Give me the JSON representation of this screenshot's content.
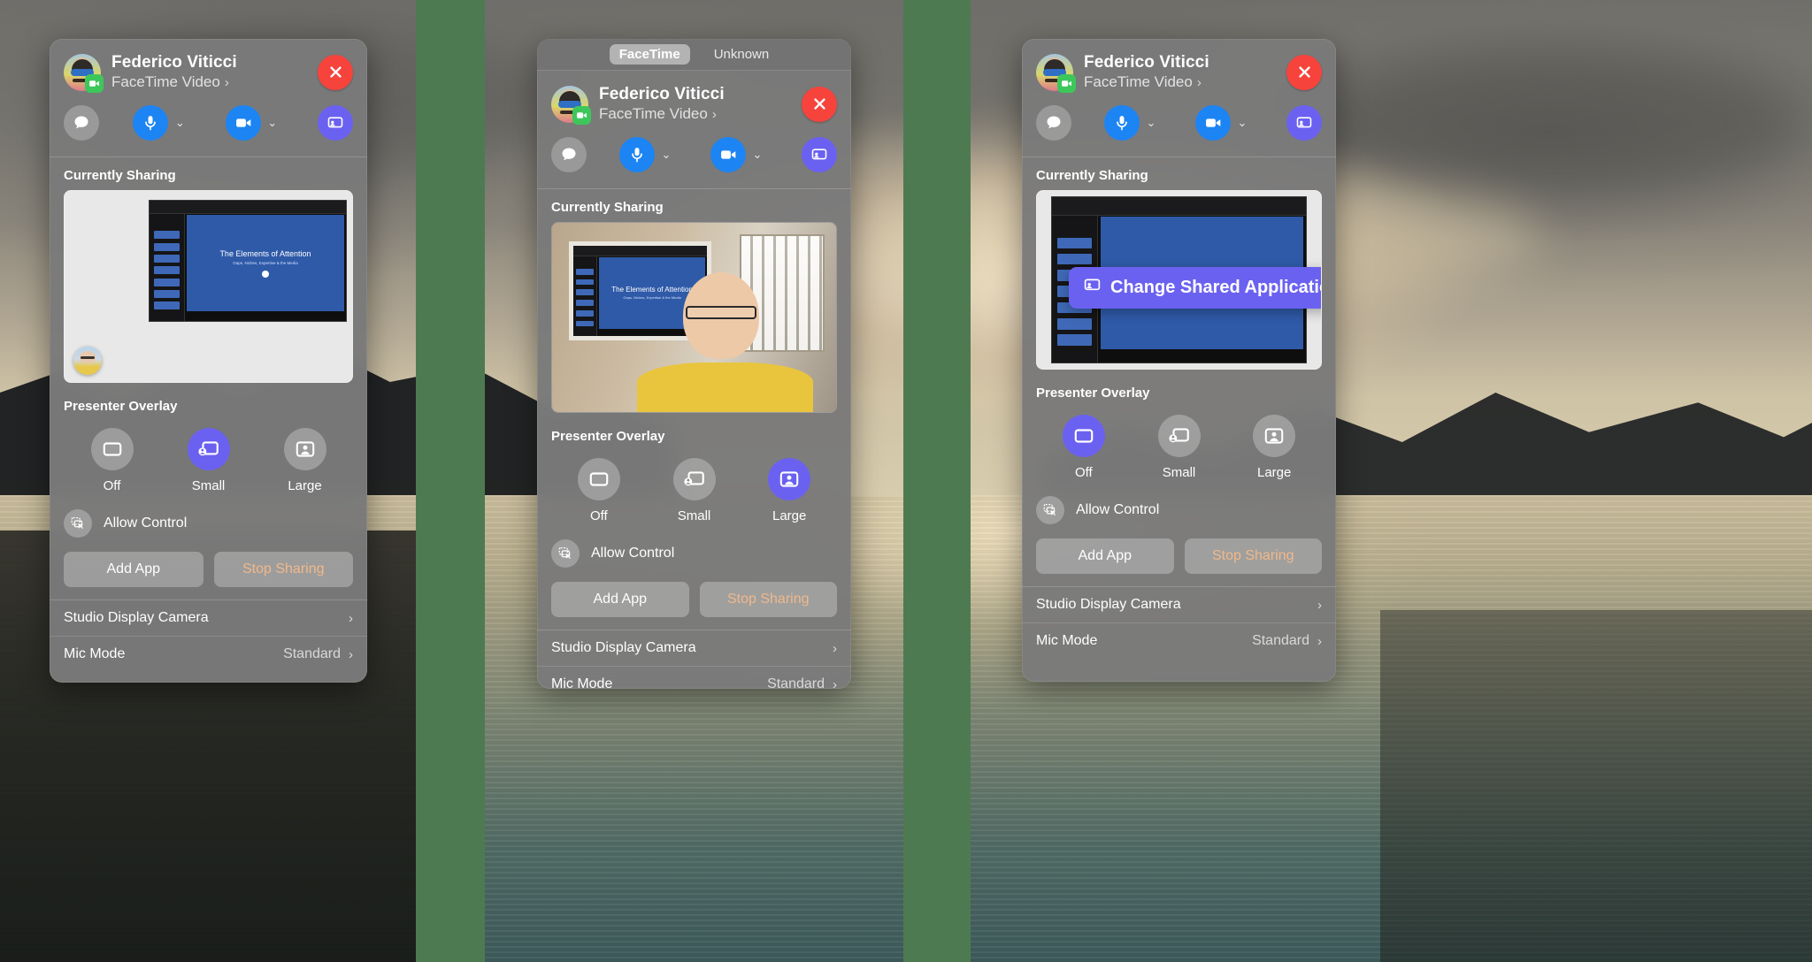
{
  "background": {
    "description": "macOS desktop wallpaper, mountain lake at dusk",
    "seam_color": "#4e7a52"
  },
  "colors": {
    "panel": "#7a7a7a",
    "accent_blue": "#1d84f3",
    "accent_purple": "#6b61f0",
    "close_red": "#f6443d",
    "facetime_green": "#3dc75b",
    "stop_sharing": "#f0b98a"
  },
  "tabs": {
    "items": [
      {
        "label": "FaceTime",
        "active": true
      },
      {
        "label": "Unknown",
        "active": false
      }
    ]
  },
  "header": {
    "name": "Federico Viticci",
    "subtitle": "FaceTime Video",
    "chevron": "›",
    "avatar_name": "avatar",
    "badge_name": "facetime-video-badge",
    "close_label": "Close"
  },
  "controls": {
    "messages": "messages-icon",
    "mic": "microphone-icon",
    "mic_caret": "⌄",
    "video": "video-camera-icon",
    "video_caret": "⌄",
    "share": "screen-share-icon"
  },
  "sharing": {
    "section_title": "Currently Sharing",
    "keynote": {
      "slide_title": "The Elements of Attention",
      "slide_subtitle": "Gaps, Niches, Expertise & the Media"
    }
  },
  "presenter_overlay": {
    "section_title": "Presenter Overlay",
    "options": [
      {
        "label": "Off",
        "icon": "overlay-off-icon",
        "selected_left": false,
        "selected_mid": false,
        "selected_right": true
      },
      {
        "label": "Small",
        "icon": "overlay-small-icon",
        "selected_left": true,
        "selected_mid": false,
        "selected_right": false
      },
      {
        "label": "Large",
        "icon": "overlay-large-icon",
        "selected_left": false,
        "selected_mid": true,
        "selected_right": false
      }
    ]
  },
  "allow_control": {
    "label": "Allow Control",
    "icon": "allow-control-icon"
  },
  "actions": {
    "add_app": "Add App",
    "stop_sharing": "Stop Sharing"
  },
  "footer": {
    "rows": [
      {
        "label": "Studio Display Camera",
        "value": "",
        "chevron": "›"
      },
      {
        "label": "Mic Mode",
        "value": "Standard",
        "chevron": "›"
      }
    ]
  },
  "tooltip": {
    "label": "Change Shared Application",
    "icon": "screen-share-icon"
  }
}
